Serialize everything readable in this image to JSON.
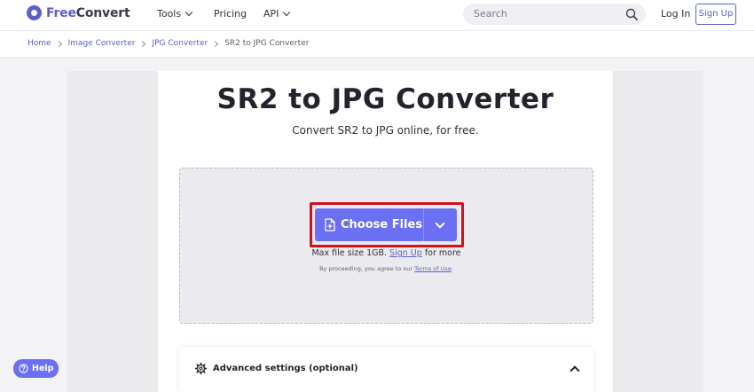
{
  "header": {
    "logo_free": "Free",
    "logo_convert": "Convert",
    "nav": {
      "tools": "Tools",
      "pricing": "Pricing",
      "api": "API"
    },
    "search_placeholder": "Search",
    "login": "Log In",
    "signup": "Sign Up"
  },
  "breadcrumb": [
    "Home",
    "Image Converter",
    "JPG Converter",
    "SR2 to JPG Converter"
  ],
  "main": {
    "title": "SR2 to JPG Converter",
    "subtitle": "Convert SR2 to JPG online, for free.",
    "choose_files": "Choose Files",
    "max_prefix": "Max file size 1GB.",
    "max_link": "Sign Up",
    "max_suffix": "for more",
    "terms_prefix": "By proceeding, you agree to our",
    "terms_link": "Terms of Use",
    "terms_suffix": "."
  },
  "advanced": {
    "label": "Advanced settings (optional)"
  },
  "help": {
    "label": "Help"
  },
  "colors": {
    "brand": "#5b5fc7",
    "button": "#6b6ff2",
    "highlight": "#d0111f"
  },
  "icons": [
    "logo-icon",
    "chevron-down-icon",
    "search-icon",
    "chevron-right-icon",
    "file-add-icon",
    "gear-icon",
    "chevron-up-icon",
    "help-icon"
  ]
}
